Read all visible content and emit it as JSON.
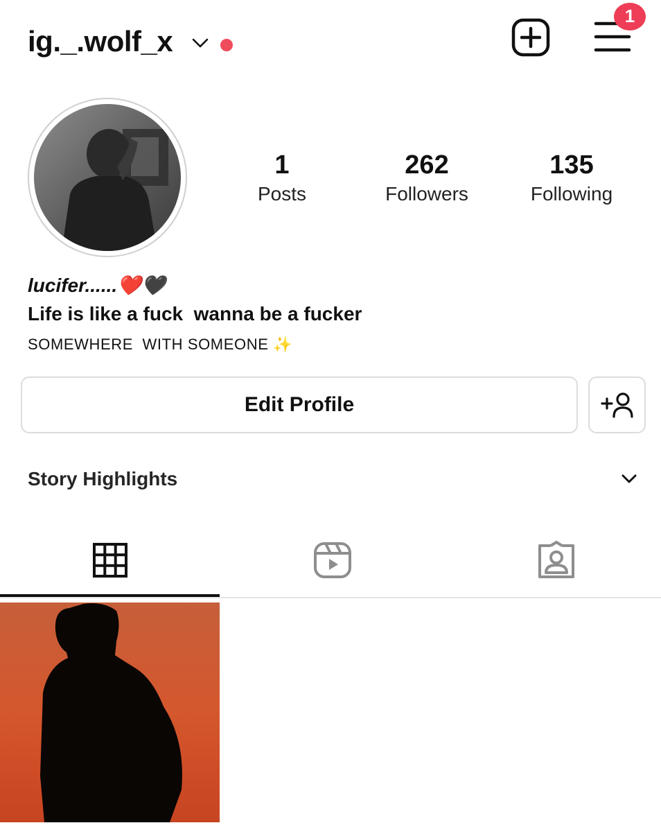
{
  "header": {
    "username": "ig._.wolf_x",
    "notification_count": "1",
    "online_dot_color": "#ef4b5c",
    "badge_color": "#ee3d56"
  },
  "profile": {
    "stats": [
      {
        "value": "1",
        "label": "Posts"
      },
      {
        "value": "262",
        "label": "Followers"
      },
      {
        "value": "135",
        "label": "Following"
      }
    ],
    "bio_name": "lucifer......❤️🖤",
    "bio_line": "Life is like a fuck  wanna be a fucker",
    "bio_location": "SOMEWHERE  WITH SOMEONE ✨"
  },
  "actions": {
    "edit_profile_label": "Edit Profile"
  },
  "highlights": {
    "title": "Story Highlights"
  },
  "tabs": [
    {
      "icon": "grid-icon",
      "selected": true
    },
    {
      "icon": "reels-icon",
      "selected": false
    },
    {
      "icon": "tagged-icon",
      "selected": false
    }
  ],
  "posts": [
    {
      "description": "silhouette"
    }
  ]
}
